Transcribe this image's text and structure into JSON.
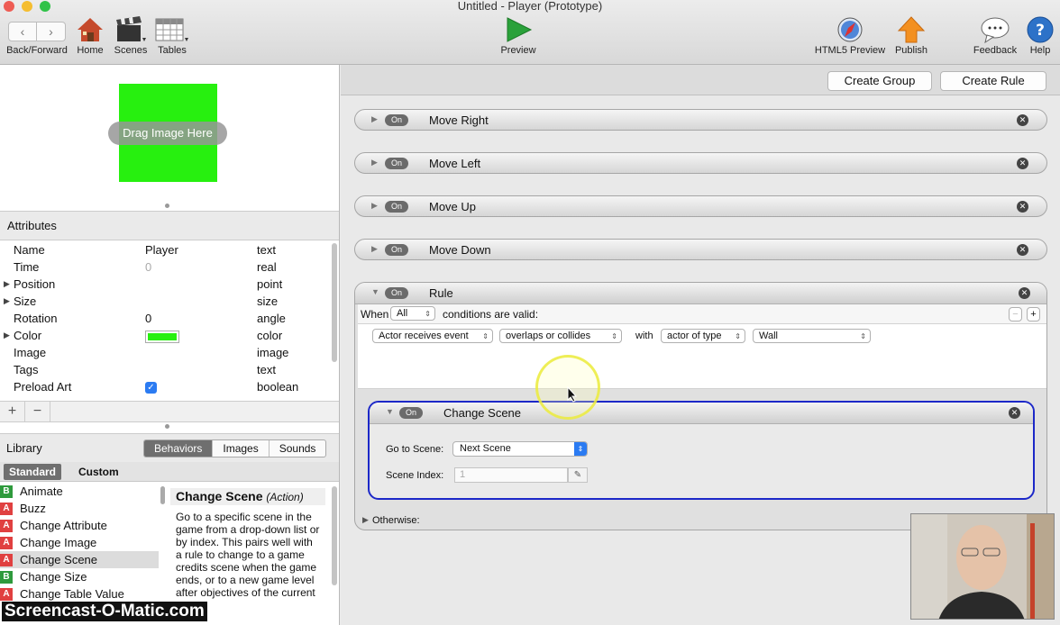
{
  "window": {
    "title": "Untitled - Player (Prototype)"
  },
  "toolbar": {
    "back_forward": "Back/Forward",
    "home": "Home",
    "scenes": "Scenes",
    "tables": "Tables",
    "preview": "Preview",
    "html5_preview": "HTML5 Preview",
    "publish": "Publish",
    "feedback": "Feedback",
    "help": "Help"
  },
  "preview": {
    "drag_image": "Drag Image Here",
    "actor_color": "#27f00f"
  },
  "attributes": {
    "header": "Attributes",
    "rows": [
      {
        "name": "Name",
        "value": "Player",
        "type": "text"
      },
      {
        "name": "Time",
        "value": "0",
        "type": "real"
      },
      {
        "name": "Position",
        "value": "",
        "type": "point"
      },
      {
        "name": "Size",
        "value": "",
        "type": "size"
      },
      {
        "name": "Rotation",
        "value": "0",
        "type": "angle"
      },
      {
        "name": "Color",
        "value": "",
        "type": "color"
      },
      {
        "name": "Image",
        "value": "",
        "type": "image"
      },
      {
        "name": "Tags",
        "value": "",
        "type": "text"
      },
      {
        "name": "Preload Art",
        "value": "",
        "type": "boolean"
      }
    ],
    "add": "+",
    "remove": "−"
  },
  "library": {
    "title": "Library",
    "tabs": [
      "Behaviors",
      "Images",
      "Sounds"
    ],
    "subtabs": [
      "Standard",
      "Custom"
    ],
    "items": [
      {
        "badge": "B",
        "name": "Animate"
      },
      {
        "badge": "A",
        "name": "Buzz"
      },
      {
        "badge": "A",
        "name": "Change Attribute"
      },
      {
        "badge": "A",
        "name": "Change Image"
      },
      {
        "badge": "A",
        "name": "Change Scene"
      },
      {
        "badge": "B",
        "name": "Change Size"
      },
      {
        "badge": "A",
        "name": "Change Table Value"
      }
    ],
    "desc_title": "Change Scene",
    "desc_kind": "(Action)",
    "desc_text": "Go to a specific scene in the game from a drop-down list or by index. This pairs well with a rule to change to a game credits scene when the game ends, or to a new game level after objectives of the current"
  },
  "rules": {
    "create_group": "Create Group",
    "create_rule": "Create Rule",
    "on_label": "On",
    "behaviors": [
      "Move Right",
      "Move Left",
      "Move Up",
      "Move Down"
    ],
    "rule": {
      "name": "Rule",
      "when": "When",
      "all": "All",
      "conditions_valid": "conditions are valid:",
      "cond_event": "Actor receives event",
      "cond_overlap": "overlaps or collides",
      "with": "with",
      "actor_of_type": "actor of type",
      "target": "Wall",
      "otherwise": "Otherwise:"
    },
    "change_scene": {
      "name": "Change Scene",
      "go_to_label": "Go to Scene:",
      "go_to_value": "Next Scene",
      "index_label": "Scene Index:",
      "index_value": "1"
    }
  },
  "watermark": "Screencast-O-Matic.com"
}
